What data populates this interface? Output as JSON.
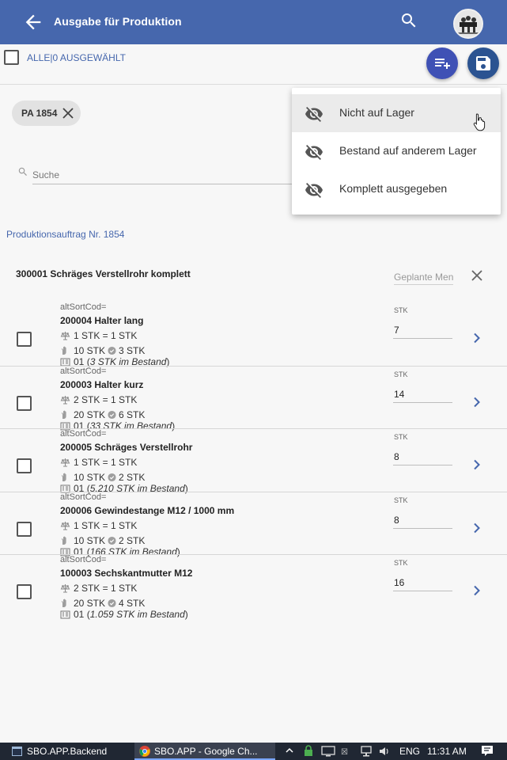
{
  "header": {
    "title": "Ausgabe für Produktion"
  },
  "selection": {
    "label": "ALLE|0 AUSGEWÄHLT"
  },
  "filter_chip": {
    "label": "PA 1854"
  },
  "search": {
    "placeholder": "Suche"
  },
  "production_order": {
    "label": "Produktionsauftrag Nr. 1854"
  },
  "group": {
    "title": "300001 Schräges Verstellrohr komplett",
    "planned_placeholder": "Geplante Menge"
  },
  "items": [
    {
      "alt": "altSortCod=",
      "name": "200004 Halter lang",
      "conversion": "1 STK = 1 STK",
      "qty_left": "10 STK",
      "qty_right": "3 STK",
      "location": "01",
      "stock": "3 STK im Bestand",
      "unit": "STK",
      "amount": "7"
    },
    {
      "alt": "altSortCod=",
      "name": "200003 Halter kurz",
      "conversion": "2 STK = 1 STK",
      "qty_left": "20 STK",
      "qty_right": "6 STK",
      "location": "01",
      "stock": "33 STK im Bestand",
      "unit": "STK",
      "amount": "14"
    },
    {
      "alt": "altSortCod=",
      "name": "200005 Schräges Verstellrohr",
      "conversion": "1 STK = 1 STK",
      "qty_left": "10 STK",
      "qty_right": "2 STK",
      "location": "01",
      "stock": "5.210 STK im Bestand",
      "unit": "STK",
      "amount": "8"
    },
    {
      "alt": "altSortCod=",
      "name": "200006 Gewindestange M12 / 1000 mm",
      "conversion": "1 STK = 1 STK",
      "qty_left": "10 STK",
      "qty_right": "2 STK",
      "location": "01",
      "stock": "166 STK im Bestand",
      "unit": "STK",
      "amount": "8"
    },
    {
      "alt": "altSortCod=",
      "name": "100003 Sechskantmutter M12",
      "conversion": "2 STK = 1 STK",
      "qty_left": "20 STK",
      "qty_right": "4 STK",
      "location": "01",
      "stock": "1.059 STK im Bestand",
      "unit": "STK",
      "amount": "16"
    }
  ],
  "menu": [
    {
      "label": "Nicht auf Lager",
      "icon": "eye-off-icon",
      "highlighted": true
    },
    {
      "label": "Bestand auf anderem Lager",
      "icon": "eye-off-icon",
      "highlighted": false
    },
    {
      "label": "Komplett ausgegeben",
      "icon": "eye-off-icon",
      "highlighted": false
    }
  ],
  "taskbar": {
    "tasks": [
      "SBO.APP.Backend",
      "SBO.APP - Google Ch..."
    ],
    "language": "ENG",
    "time": "11:31 AM"
  },
  "colors": {
    "appbar": "#4667ad",
    "fab_add": "#3f51b5",
    "fab_save": "#2b5391",
    "link": "#4667ad"
  }
}
